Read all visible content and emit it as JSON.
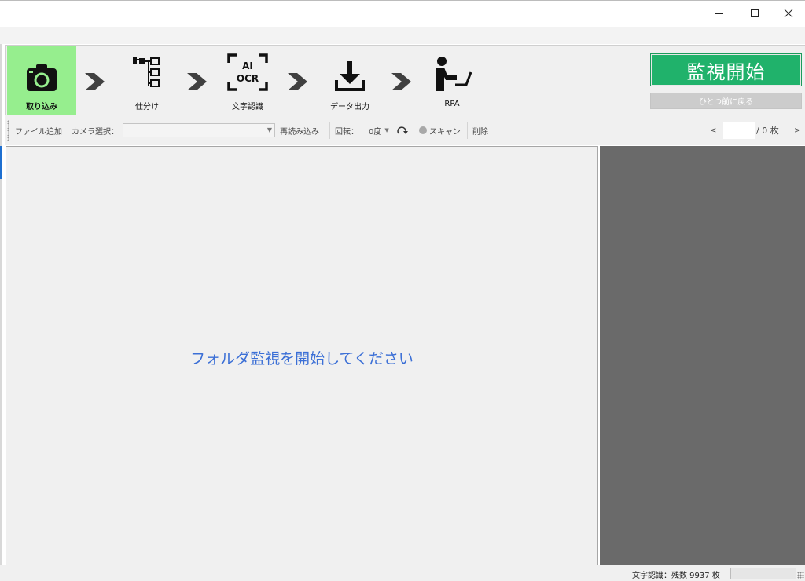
{
  "window": {
    "minimize_icon": "minimize-icon",
    "maximize_icon": "maximize-icon",
    "close_icon": "close-icon"
  },
  "ribbon": {
    "steps": [
      {
        "label": "取り込み",
        "icon": "camera-icon",
        "active": true
      },
      {
        "label": "仕分け",
        "icon": "tree-icon",
        "active": false
      },
      {
        "label": "文字認識",
        "icon": "ai-ocr-icon",
        "icon_text_top": "AI",
        "icon_text_bottom": "OCR",
        "active": false
      },
      {
        "label": "データ出力",
        "icon": "download-icon",
        "active": false
      },
      {
        "label": "RPA",
        "icon": "person-computer-icon",
        "active": false
      }
    ],
    "start_button": "監視開始",
    "back_button": "ひとつ前に戻る"
  },
  "toolbar": {
    "add_file": "ファイル追加",
    "camera_select_label": "カメラ選択：",
    "camera_select_value": "",
    "reload": "再読み込み",
    "rotate_label": "回転：",
    "rotate_value": "0度",
    "scan": "スキャン",
    "delete": "削除",
    "page_prev": "<",
    "page_current": "",
    "page_total": "/ 0 枚",
    "page_next": ">"
  },
  "main": {
    "message": "フォルダ監視を開始してください"
  },
  "status": {
    "remaining": "文字認識：残数 9937 枚"
  },
  "colors": {
    "active_step": "#96ee8e",
    "start_button": "#20b26b",
    "message_text": "#3b6fd6",
    "preview_panel": "#6a6a6a"
  }
}
